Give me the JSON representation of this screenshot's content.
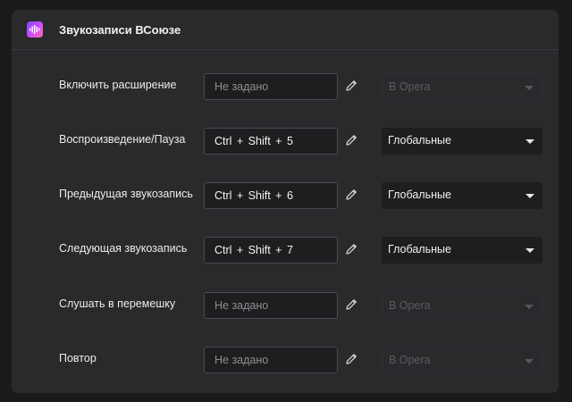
{
  "header": {
    "title": "Звукозаписи ВСоюзе",
    "icon": "waveform-icon"
  },
  "colors": {
    "panel_bg": "#2a2a2d",
    "field_bg": "#1e1e20",
    "icon_gradient_start": "#7a4dff",
    "icon_gradient_end": "#ff6ab0"
  },
  "shortcuts": [
    {
      "label": "Включить расширение",
      "shortcut": "Не задано",
      "is_set": false,
      "scope": "В Opera",
      "scope_enabled": false
    },
    {
      "label": "Воспроизведение/Пауза",
      "shortcut": "Ctrl + Shift + 5",
      "is_set": true,
      "scope": "Глобальные",
      "scope_enabled": true
    },
    {
      "label": "Предыдущая звукозапись",
      "shortcut": "Ctrl + Shift + 6",
      "is_set": true,
      "scope": "Глобальные",
      "scope_enabled": true
    },
    {
      "label": "Следующая звукозапись",
      "shortcut": "Ctrl + Shift + 7",
      "is_set": true,
      "scope": "Глобальные",
      "scope_enabled": true
    },
    {
      "label": "Слушать в перемешку",
      "shortcut": "Не задано",
      "is_set": false,
      "scope": "В Opera",
      "scope_enabled": false
    },
    {
      "label": "Повтор",
      "shortcut": "Не задано",
      "is_set": false,
      "scope": "В Opera",
      "scope_enabled": false
    }
  ]
}
